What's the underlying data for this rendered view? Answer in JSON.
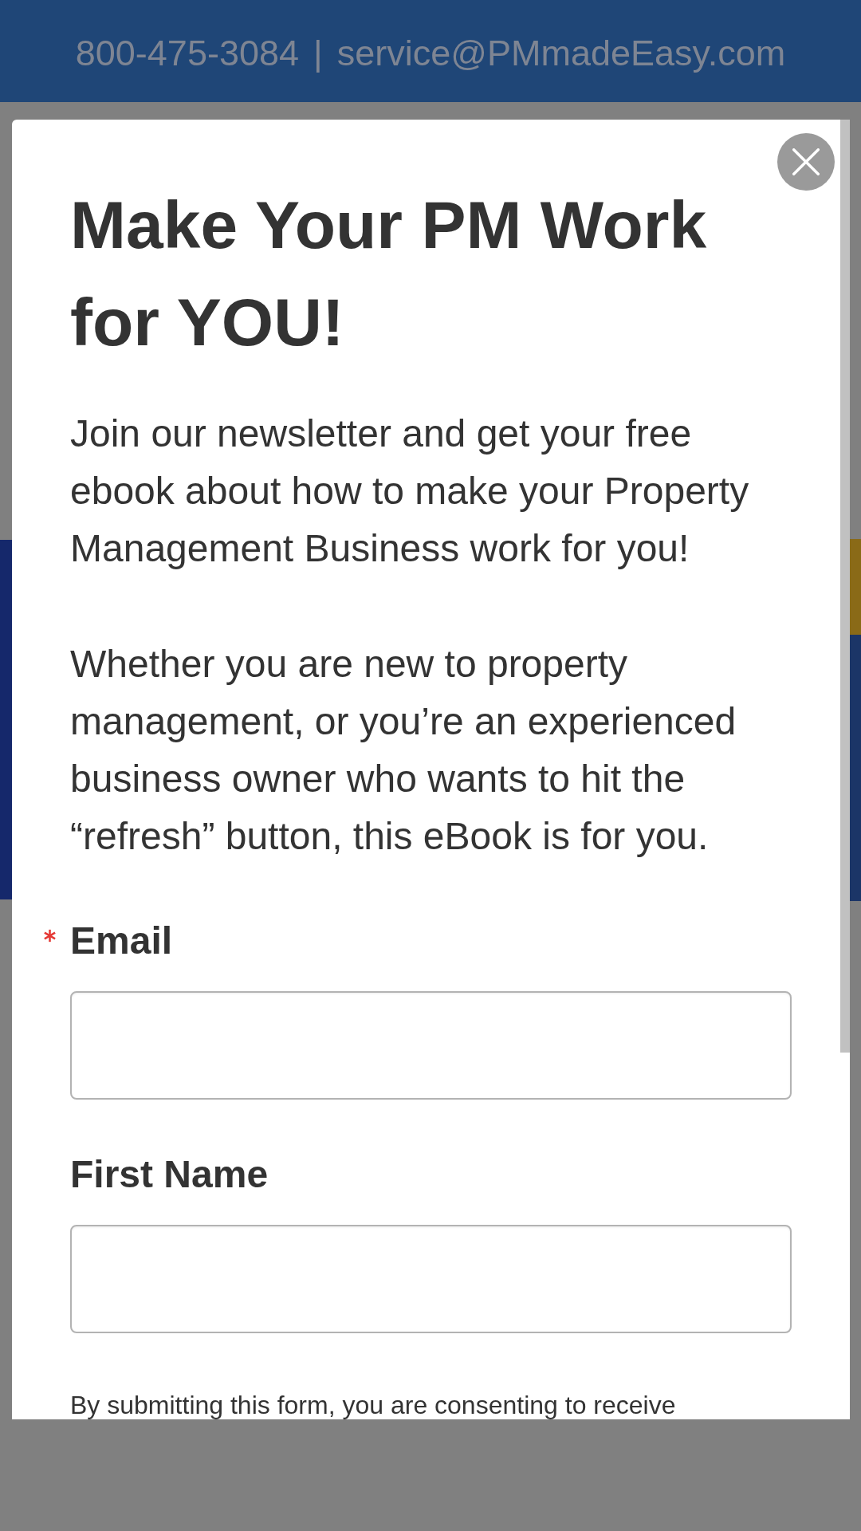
{
  "top_bar": {
    "phone": "800-475-3084",
    "separator": "|",
    "email": "service@PMmadeEasy.com"
  },
  "modal": {
    "title": "Make Your PM Work for YOU!",
    "paragraphs": [
      "Join our newsletter and get your free ebook about how to make your Property Management Business work for you!",
      "Whether you are new to property management, or you’re an experienced business owner who wants to hit the “refresh” button, this eBook is for you."
    ],
    "fields": [
      {
        "label": "Email",
        "required": true
      },
      {
        "label": "First Name",
        "required": false
      }
    ],
    "consent_text": "By submitting this form, you are consenting to receive"
  }
}
